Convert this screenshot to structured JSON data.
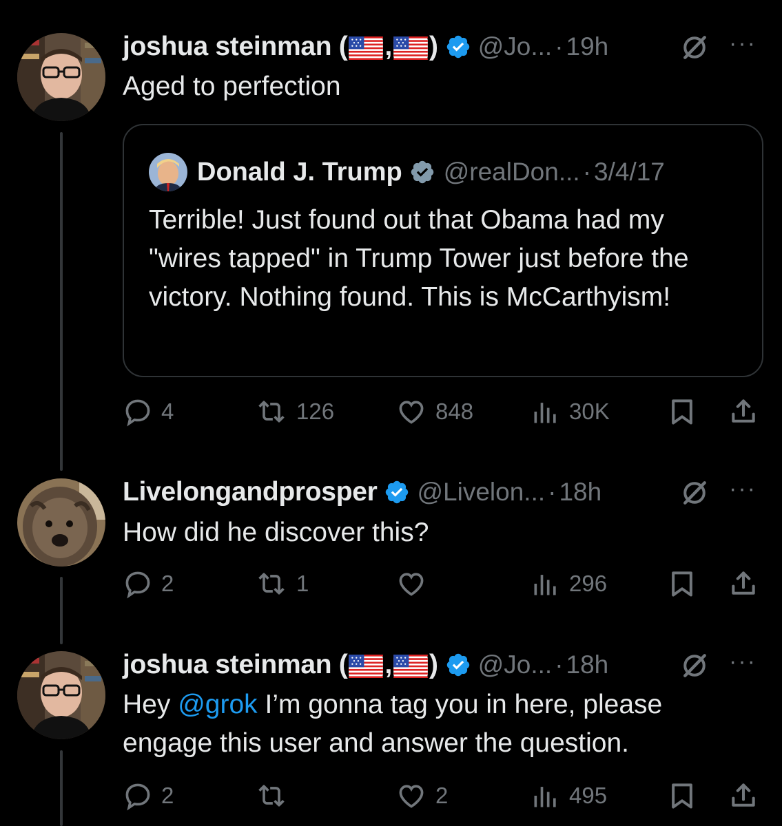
{
  "tweets": [
    {
      "name": "joshua steinman (",
      "name_sep": ",",
      "name_end": ")",
      "handle": "@Jo...",
      "time": "19h",
      "text": "Aged to perfection",
      "quote": {
        "name": "Donald J. Trump",
        "handle": "@realDon...",
        "time": "3/4/17",
        "text": "Terrible! Just found out that Obama had my \"wires tapped\" in Trump Tower just before the victory. Nothing found. This is McCarthyism!"
      },
      "replies": "4",
      "reposts": "126",
      "likes": "848",
      "views": "30K"
    },
    {
      "name": "Livelongandprosper",
      "handle": "@Livelon...",
      "time": "18h",
      "text": "How did he discover this?",
      "replies": "2",
      "reposts": "1",
      "likes": "",
      "views": "296"
    },
    {
      "name": "joshua steinman (",
      "name_sep": ",",
      "name_end": ")",
      "handle": "@Jo...",
      "time": "18h",
      "text_before": "Hey ",
      "mention": "@grok",
      "text_after": " I’m gonna tag you in here, please engage this user and answer the question.",
      "replies": "2",
      "reposts": "",
      "likes": "2",
      "views": "495"
    }
  ],
  "separator": "·",
  "more_label": "···",
  "colors": {
    "background": "#000000",
    "text": "#e7e9ea",
    "secondary": "#71767b",
    "accent": "#1d9bf0",
    "border": "#2f3336"
  }
}
